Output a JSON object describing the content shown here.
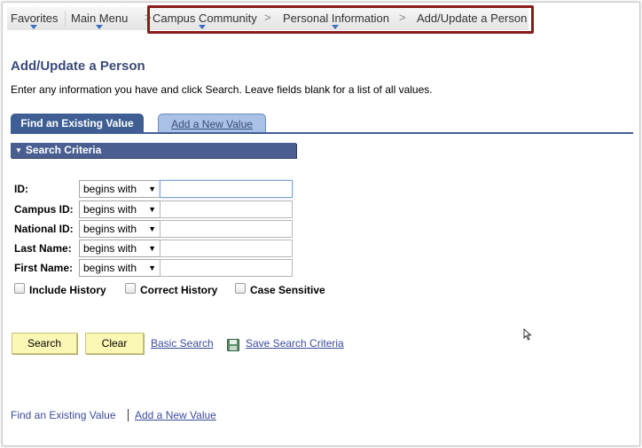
{
  "nav": {
    "favorites": "Favorites",
    "main_menu": "Main Menu",
    "breadcrumbs": [
      "Campus Community",
      "Personal Information",
      "Add/Update a Person"
    ],
    "separator": ">"
  },
  "page": {
    "title": "Add/Update a Person",
    "instructions": "Enter any information you have and click Search. Leave fields blank for a list of all values."
  },
  "tabs": {
    "active": "Find an Existing Value",
    "inactive": "Add a New Value"
  },
  "search_criteria": {
    "header": "Search Criteria",
    "fields": [
      {
        "label": "ID:",
        "operator": "begins with",
        "value": ""
      },
      {
        "label": "Campus ID:",
        "operator": "begins with",
        "value": ""
      },
      {
        "label": "National ID:",
        "operator": "begins with",
        "value": ""
      },
      {
        "label": "Last Name:",
        "operator": "begins with",
        "value": ""
      },
      {
        "label": "First Name:",
        "operator": "begins with",
        "value": ""
      }
    ],
    "checkboxes": [
      "Include History",
      "Correct History",
      "Case Sensitive"
    ]
  },
  "actions": {
    "search": "Search",
    "clear": "Clear",
    "basic_search": "Basic Search",
    "save_search_criteria": "Save Search Criteria"
  },
  "footer": {
    "find_existing": "Find an Existing Value",
    "add_new": "Add a New Value"
  },
  "colors": {
    "highlight_border": "#8b1a1a",
    "tab_active": "#3f5f94",
    "button_yellow": "#fbf7b5"
  }
}
